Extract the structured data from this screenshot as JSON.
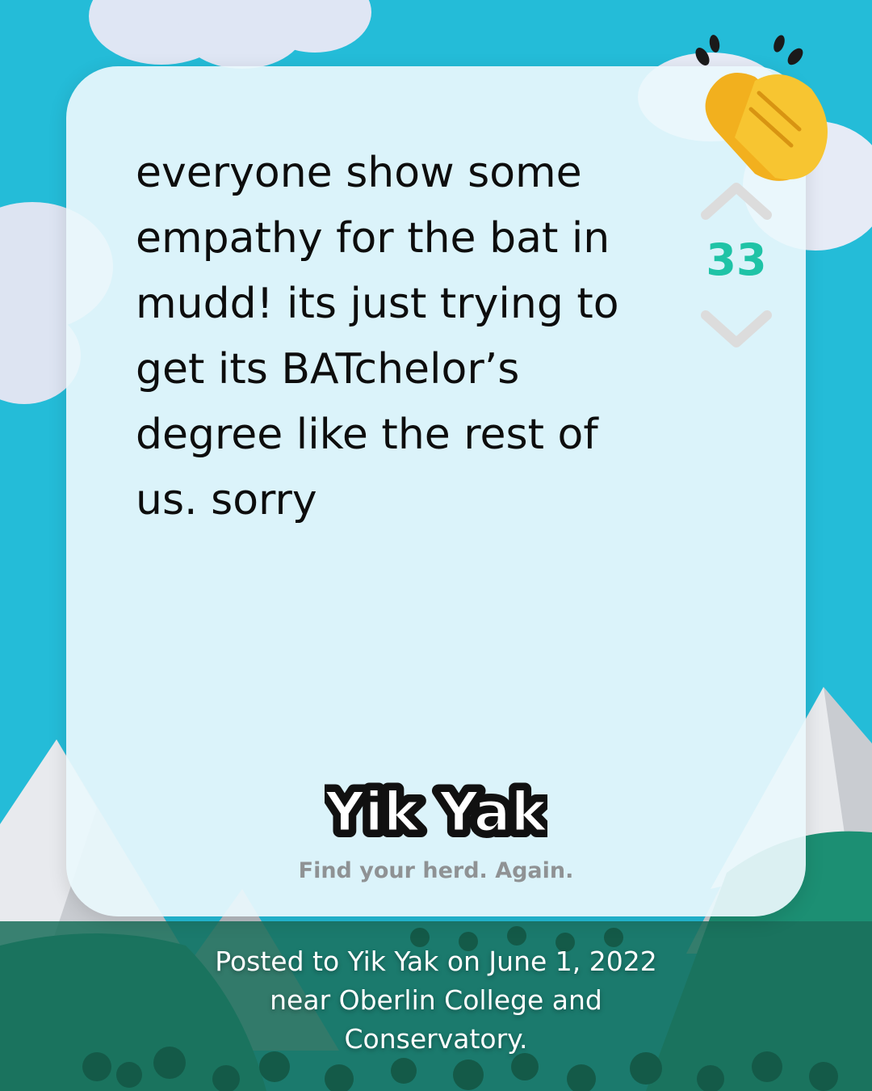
{
  "post": {
    "text": "everyone show some\nempathy for the bat in\nmudd! its just trying to\nget its BATchelor’s\ndegree like the rest of\nus. sorry",
    "score": "33",
    "upvote_icon": "chevron-up-icon",
    "downvote_icon": "chevron-down-icon",
    "reaction_icon": "clapping-hands-icon"
  },
  "brand": {
    "logo_text": "Yik Yak",
    "tagline": "Find your herd. Again."
  },
  "footer": {
    "caption": "Posted to Yik Yak on June 1, 2022\nnear Oberlin College and\nConservatory."
  },
  "colors": {
    "sky": "#24bcd8",
    "score": "#1fc3a6",
    "card": "#eaf8fc",
    "grass": "#1f8f73"
  }
}
